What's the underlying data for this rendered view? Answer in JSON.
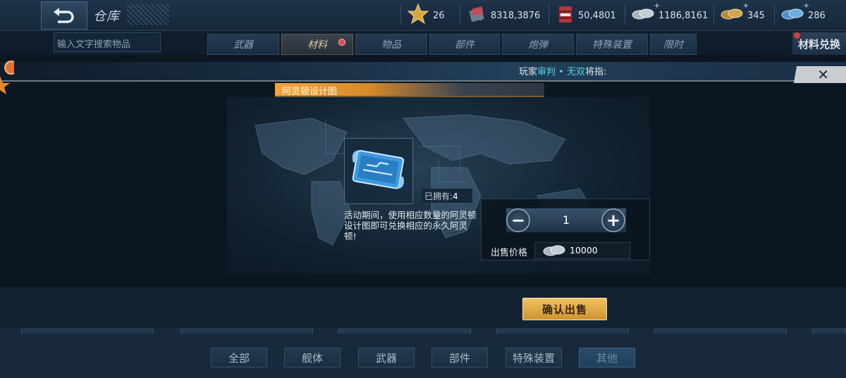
{
  "header": {
    "title": "仓库",
    "resources": [
      {
        "icon": "star-icon",
        "value": "26",
        "plus": false
      },
      {
        "icon": "supply-crate-icon",
        "value": "8318,3876",
        "plus": false
      },
      {
        "icon": "fuel-barrel-icon",
        "value": "50,4801",
        "plus": false
      },
      {
        "icon": "silver-coins-icon",
        "value": "1186,8161",
        "plus": true
      },
      {
        "icon": "gold-coins-icon",
        "value": "345",
        "plus": true
      },
      {
        "icon": "blue-gems-icon",
        "value": "286",
        "plus": true
      }
    ]
  },
  "search": {
    "placeholder": "输入文字搜索物品"
  },
  "tabs": [
    {
      "label": "武器",
      "active": false
    },
    {
      "label": "材料",
      "active": true,
      "badge": true
    },
    {
      "label": "物品",
      "active": false
    },
    {
      "label": "部件",
      "active": false
    },
    {
      "label": "炮弹",
      "active": false
    },
    {
      "label": "特殊装置",
      "active": false
    },
    {
      "label": "限时",
      "active": false
    }
  ],
  "exchange_button": "材料兑换",
  "news": {
    "prefix": "玩家",
    "player": "审判 • 无双",
    "suffix": "将指:"
  },
  "modal": {
    "item_name": "阿灵顿设计图",
    "owned_label": "已拥有:",
    "owned_value": "4",
    "description": "活动期间，使用相应数量的阿灵顿设计图即可兑换相应的永久阿灵顿!",
    "quantity": "1",
    "price_label": "出售价格",
    "price_value": "10000",
    "confirm_label": "确认出售"
  },
  "filters": [
    {
      "label": "全部",
      "active": false
    },
    {
      "label": "舰体",
      "active": false
    },
    {
      "label": "武器",
      "active": false
    },
    {
      "label": "部件",
      "active": false
    },
    {
      "label": "特殊装置",
      "active": false
    },
    {
      "label": "其他",
      "active": true
    }
  ],
  "colors": {
    "accent_gold": "#f1c25e",
    "highlight_cyan": "#4fd0e3",
    "tab_badge_red": "#e04a55",
    "item_bar_orange": "#f2a43a"
  }
}
